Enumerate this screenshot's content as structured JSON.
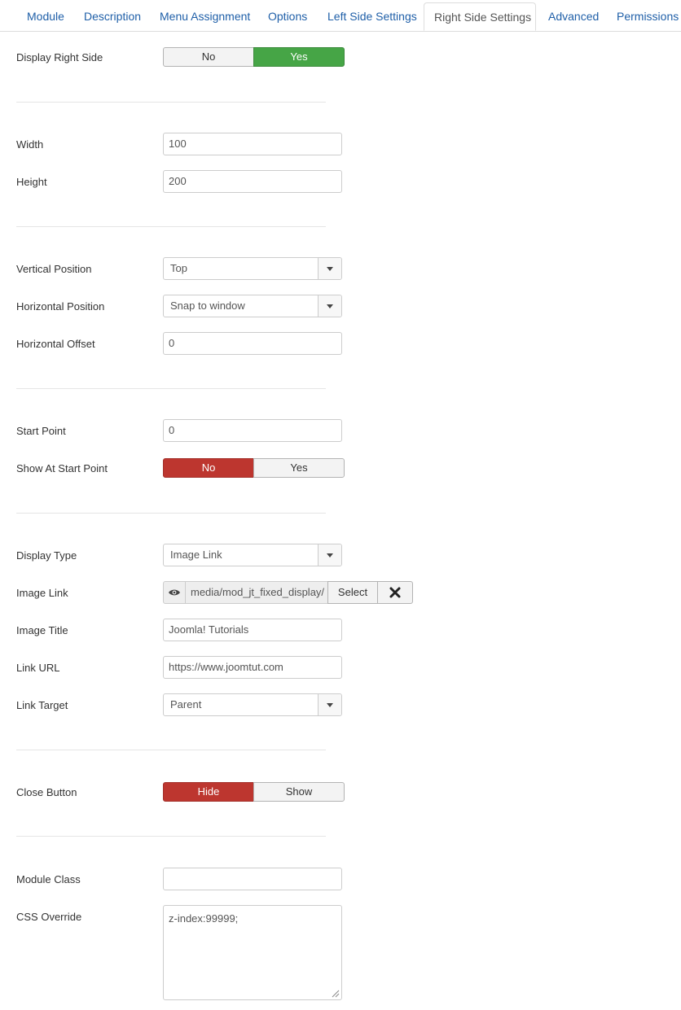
{
  "tabs": [
    "Module",
    "Description",
    "Menu Assignment",
    "Options",
    "Left Side Settings",
    "Right Side Settings",
    "Advanced",
    "Permissions"
  ],
  "active_tab": "Right Side Settings",
  "fields": {
    "display_right_side": {
      "label": "Display Right Side",
      "no": "No",
      "yes": "Yes",
      "selected": "Yes"
    },
    "width": {
      "label": "Width",
      "value": "100"
    },
    "height": {
      "label": "Height",
      "value": "200"
    },
    "vertical_position": {
      "label": "Vertical Position",
      "value": "Top"
    },
    "horizontal_position": {
      "label": "Horizontal Position",
      "value": "Snap to window"
    },
    "horizontal_offset": {
      "label": "Horizontal Offset",
      "value": "0"
    },
    "start_point": {
      "label": "Start Point",
      "value": "0"
    },
    "show_at_start_point": {
      "label": "Show At Start Point",
      "no": "No",
      "yes": "Yes",
      "selected": "No"
    },
    "display_type": {
      "label": "Display Type",
      "value": "Image Link"
    },
    "image_link": {
      "label": "Image Link",
      "value": "media/mod_jt_fixed_display/",
      "select_label": "Select",
      "clear_icon": "close-icon"
    },
    "image_title": {
      "label": "Image Title",
      "value": "Joomla! Tutorials"
    },
    "link_url": {
      "label": "Link URL",
      "value": "https://www.joomtut.com"
    },
    "link_target": {
      "label": "Link Target",
      "value": "Parent"
    },
    "close_button": {
      "label": "Close Button",
      "hide": "Hide",
      "show": "Show",
      "selected": "Hide"
    },
    "module_class": {
      "label": "Module Class",
      "value": ""
    },
    "css_override": {
      "label": "CSS Override",
      "value": "z-index:99999;"
    }
  },
  "colors": {
    "accent_link": "#1f5fa8",
    "yes_green": "#46a546",
    "no_red": "#bd362f"
  }
}
